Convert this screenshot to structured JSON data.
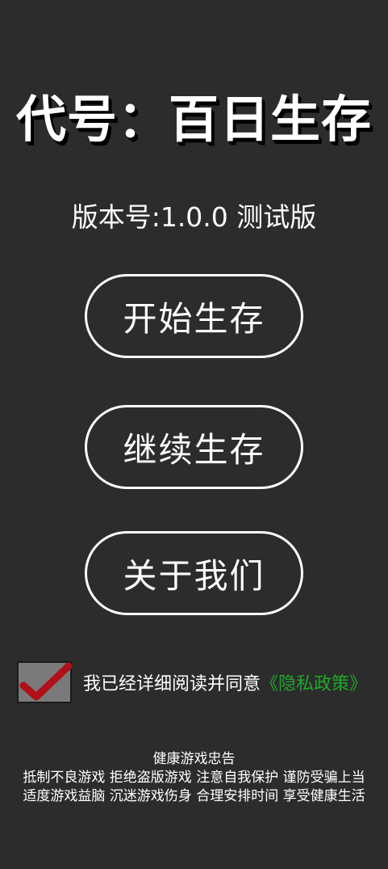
{
  "game": {
    "title": "代号：百日生存",
    "version": "版本号:1.0.0 测试版"
  },
  "menu": {
    "start_label": "开始生存",
    "continue_label": "继续生存",
    "about_label": "关于我们"
  },
  "agreement": {
    "checked": true,
    "text": "我已经详细阅读并同意",
    "policy_link": "《隐私政策》"
  },
  "health_notice": {
    "title": "健康游戏忠告",
    "line1": "抵制不良游戏 拒绝盗版游戏 注意自我保护 谨防受骗上当",
    "line2": "适度游戏益脑 沉迷游戏伤身 合理安排时间 享受健康生活"
  },
  "colors": {
    "background": "#2c2c2c",
    "text": "#ffffff",
    "checkmark": "#b0101a",
    "checkbox": "#7a7a7a",
    "policy_link": "#21a62b"
  },
  "icons": {
    "checkbox": "checkmark-icon"
  }
}
